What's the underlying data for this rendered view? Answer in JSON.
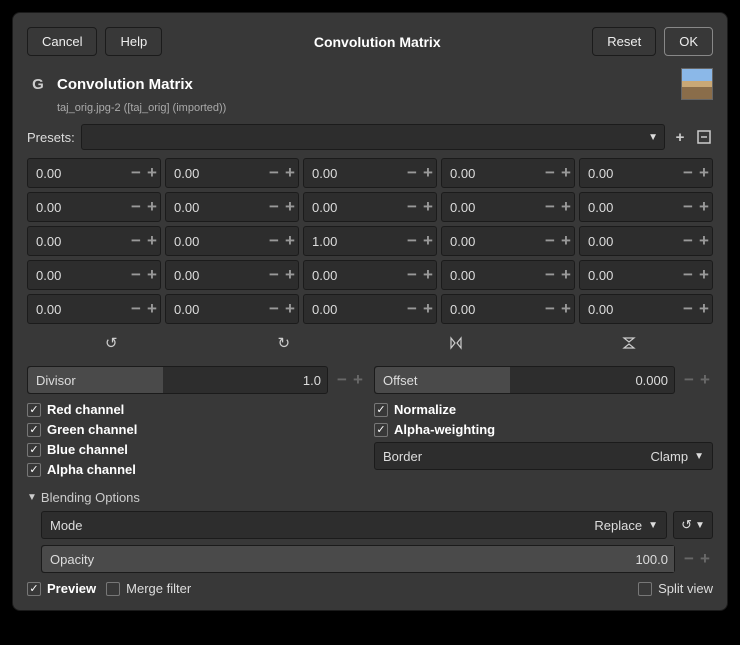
{
  "titlebar": {
    "cancel": "Cancel",
    "help": "Help",
    "title": "Convolution Matrix",
    "reset": "Reset",
    "ok": "OK"
  },
  "header": {
    "title": "Convolution Matrix",
    "subtitle": "taj_orig.jpg-2 ([taj_orig] (imported))"
  },
  "presets": {
    "label": "Presets:"
  },
  "matrix": [
    [
      "0.00",
      "0.00",
      "0.00",
      "0.00",
      "0.00"
    ],
    [
      "0.00",
      "0.00",
      "0.00",
      "0.00",
      "0.00"
    ],
    [
      "0.00",
      "0.00",
      "1.00",
      "0.00",
      "0.00"
    ],
    [
      "0.00",
      "0.00",
      "0.00",
      "0.00",
      "0.00"
    ],
    [
      "0.00",
      "0.00",
      "0.00",
      "0.00",
      "0.00"
    ]
  ],
  "divisor": {
    "label": "Divisor",
    "value": "1.0"
  },
  "offset": {
    "label": "Offset",
    "value": "0.000"
  },
  "channels": {
    "red": "Red channel",
    "green": "Green channel",
    "blue": "Blue channel",
    "alpha": "Alpha channel"
  },
  "options": {
    "normalize": "Normalize",
    "alpha_weighting": "Alpha-weighting"
  },
  "border": {
    "label": "Border",
    "value": "Clamp"
  },
  "blending": {
    "header": "Blending Options",
    "mode_label": "Mode",
    "mode_value": "Replace",
    "opacity_label": "Opacity",
    "opacity_value": "100.0"
  },
  "footer": {
    "preview": "Preview",
    "merge": "Merge filter",
    "split": "Split view"
  }
}
